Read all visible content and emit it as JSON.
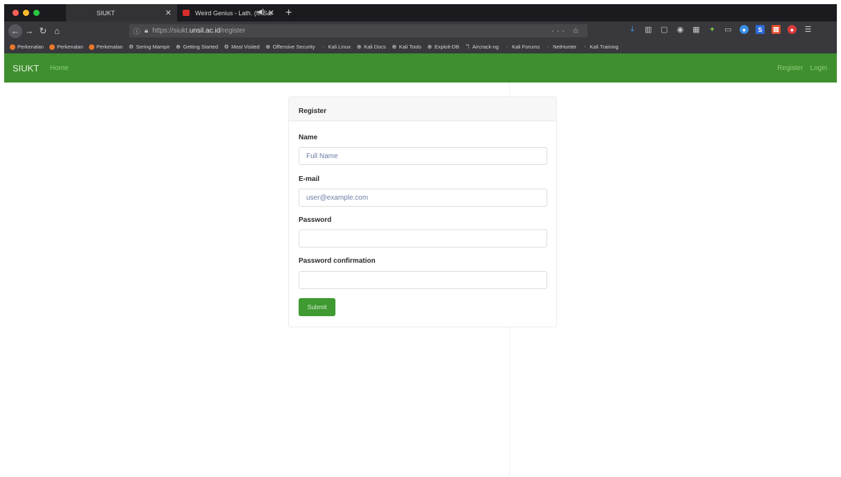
{
  "tabs": [
    {
      "title": "SIUKT",
      "active": true
    },
    {
      "title": "Weird Genius - Lath. (ft. Sar",
      "active": false
    }
  ],
  "url": {
    "prefix": "https://siukt.",
    "domain": "unsil.ac.id",
    "path": "/register"
  },
  "bookmarks": [
    "Perkenalan",
    "Perkenalan",
    "Perkenalan",
    "Sering Mampir",
    "Getting Started",
    "Most Visited",
    "Offensive Security",
    "Kali Linux",
    "Kali Docs",
    "Kali Tools",
    "Exploit-DB",
    "Aircrack-ng",
    "Kali Forums",
    "NetHunter",
    "Kali Training"
  ],
  "site": {
    "brand": "SIUKT",
    "home": "Home",
    "register": "Register",
    "login": "Login"
  },
  "form": {
    "title": "Register",
    "name_label": "Name",
    "name_placeholder": "Full Name",
    "email_label": "E-mail",
    "email_placeholder": "user@example.com",
    "password_label": "Password",
    "password_confirmation_label": "Password confirmation",
    "submit_label": "Submit"
  },
  "colors": {
    "navbar_green": "#3f8f2e",
    "button_green": "#3f9a32",
    "chrome_dark": "#38383d"
  },
  "icons": [
    "back-icon",
    "forward-icon",
    "reload-icon",
    "home-icon",
    "lock-icon",
    "star-icon",
    "download-icon",
    "library-icon"
  ]
}
